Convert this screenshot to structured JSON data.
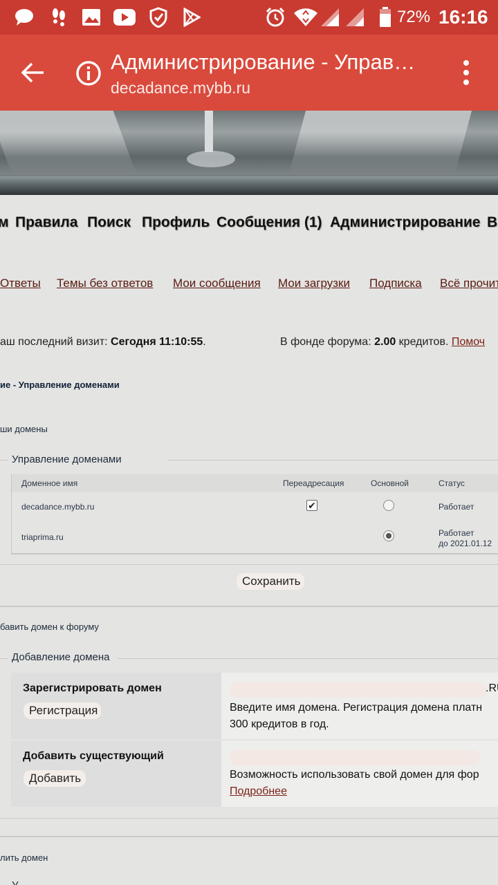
{
  "status_bar": {
    "battery": "72%",
    "time": "16:16",
    "icons": [
      "message-icon",
      "footsteps-icon",
      "image-icon",
      "youtube-icon",
      "shield-icon",
      "play-store-icon",
      "alarm-icon",
      "wifi-icon",
      "signal-icon",
      "signal-icon",
      "battery-icon"
    ]
  },
  "toolbar": {
    "title": "Администрирование - Управ…",
    "url": "decadance.mybb.ru"
  },
  "nav": {
    "main": [
      "м",
      "Правила",
      "Поиск",
      "Профиль",
      "Сообщения (1)",
      "Администрирование",
      "Вы"
    ],
    "sub": [
      "Ответы",
      "Темы без ответов",
      "Мои сообщения",
      "Мои загрузки",
      "Подписка",
      "Всё прочит"
    ]
  },
  "info": {
    "last_visit_prefix": "аш последний визит: ",
    "last_visit_value": "Сегодня 11:10:55",
    "last_visit_suffix": ".",
    "fund_prefix": "В фонде форума: ",
    "fund_value": "2.00",
    "fund_suffix": " кредитов. ",
    "fund_link": "Помоч"
  },
  "breadcrumb": "ие - Управление доменами",
  "section_domains": {
    "header": "ши домены",
    "legend": "Управление доменами",
    "columns": [
      "Доменное имя",
      "Переадресация",
      "Основной",
      "Статус"
    ],
    "rows": [
      {
        "domain": "decadance.mybb.ru",
        "redirect": true,
        "main": false,
        "status": "Работает",
        "status2": ""
      },
      {
        "domain": "triaprima.ru",
        "redirect": false,
        "main": true,
        "status": "Работает",
        "status2": "до 2021.01.12"
      }
    ],
    "save_label": "Сохранить"
  },
  "section_add": {
    "header": "бавить домен к форуму",
    "legend": "Добавление домена",
    "register_label": "Зарегистрировать домен",
    "register_button": "Регистрация",
    "register_suffix": ".RU",
    "register_desc_1": "Введите имя домена. Регистрация домена платн",
    "register_desc_2": "300 кредитов в год.",
    "existing_label": "Добавить существующий",
    "existing_button": "Добавить",
    "existing_desc": "Возможность использовать свой домен для фор",
    "existing_link": "Подробнее"
  },
  "section_delete": {
    "header": "лить домен",
    "next": "У"
  }
}
